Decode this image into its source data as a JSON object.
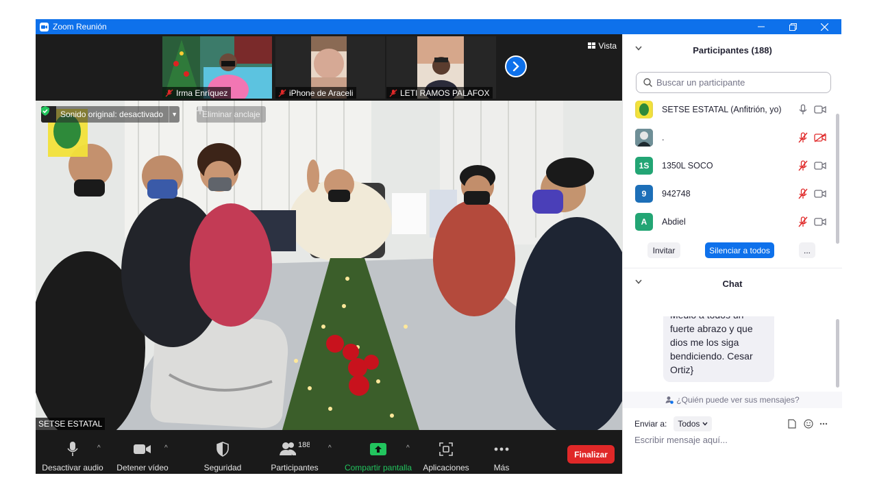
{
  "window": {
    "title": "Zoom Reunión",
    "controls": [
      "minimize-icon",
      "restore-icon",
      "close-icon"
    ]
  },
  "thumbnails": [
    {
      "name": "Irma Enríquez",
      "muted": true
    },
    {
      "name": "iPhone de Araceli",
      "muted": true
    },
    {
      "name": "LETI RAMOS PALAFOX",
      "muted": true
    }
  ],
  "vista_label": "Vista",
  "main_video": {
    "original_sound": "Sonido original: desactivado",
    "unpin_label": "Eliminar anclaje",
    "speaker_name": "SETSE ESTATAL"
  },
  "toolbar": {
    "mute_audio": "Desactivar audio",
    "stop_video": "Detener vídeo",
    "security": "Seguridad",
    "participants": "Participantes",
    "participants_count": "188",
    "share_screen": "Compartir pantalla",
    "apps": "Aplicaciones",
    "more": "Más",
    "end": "Finalizar"
  },
  "participants_panel": {
    "title": "Participantes (188)",
    "search_placeholder": "Buscar un participante",
    "list": [
      {
        "name": "SETSE ESTATAL (Anfitrión, yo)",
        "avatar": "",
        "avatar_color": "#e8d84a",
        "mic": "on",
        "cam": "on"
      },
      {
        "name": ".",
        "avatar": "",
        "avatar_color": "#3b4a4f",
        "mic": "off",
        "cam": "off"
      },
      {
        "name": "1350L SOCO",
        "avatar": "1S",
        "avatar_color": "#23a574",
        "mic": "off",
        "cam": "on"
      },
      {
        "name": "942748",
        "avatar": "9",
        "avatar_color": "#1d6fb8",
        "mic": "off",
        "cam": "on"
      },
      {
        "name": "Abdiel",
        "avatar": "A",
        "avatar_color": "#23a574",
        "mic": "off",
        "cam": "on"
      }
    ],
    "invite": "Invitar",
    "mute_all": "Silenciar a todos",
    "more": "..."
  },
  "chat_panel": {
    "title": "Chat",
    "message_lines": [
      "Medio a todos un",
      "fuerte abrazo y que",
      "dios me los siga",
      "bendiciendo. Cesar",
      "Ortiz}"
    ],
    "who_can_see": "¿Quién puede ver sus mensajes?",
    "send_to_label": "Enviar a:",
    "send_to_value": "Todos",
    "input_placeholder": "Escribir mensaje aquí..."
  },
  "colors": {
    "zoom_blue": "#0e71eb",
    "end_red": "#e02828",
    "share_green": "#22c55e",
    "muted_red": "#e02828"
  }
}
